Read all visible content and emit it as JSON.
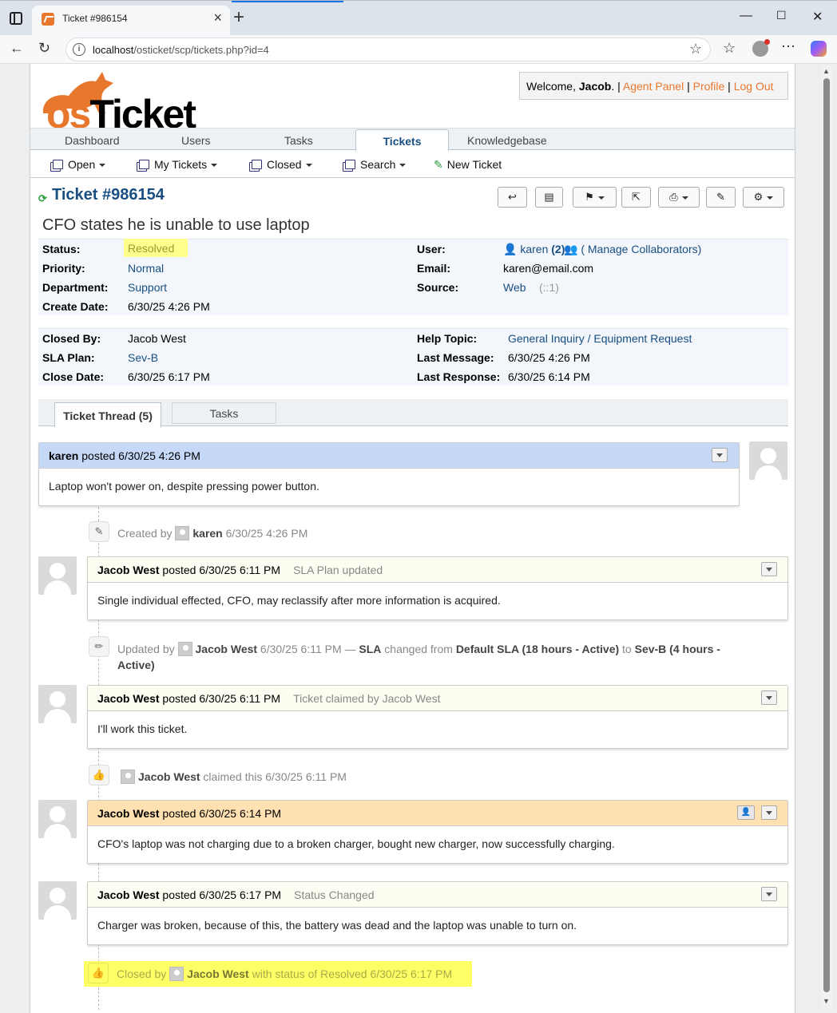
{
  "browser": {
    "tab_title": "Ticket #986154",
    "url_host": "localhost",
    "url_path": "/osticket/scp/tickets.php?id=4"
  },
  "header": {
    "logo_prefix": "os",
    "logo_suffix": "Ticket",
    "welcome_prefix": "Welcome, ",
    "user_name": "Jacob",
    "welcome_suffix": ". | ",
    "agent_panel": "Agent Panel",
    "sep1": " | ",
    "profile": "Profile",
    "sep2": " | ",
    "logout": "Log Out"
  },
  "nav": {
    "tabs": [
      "Dashboard",
      "Users",
      "Tasks",
      "Tickets",
      "Knowledgebase"
    ],
    "active": "Tickets"
  },
  "subnav": {
    "items": [
      "Open",
      "My Tickets",
      "Closed",
      "Search",
      "New Ticket"
    ]
  },
  "ticket": {
    "number": "Ticket #986154",
    "subject": "CFO states he is unable to use laptop",
    "info1": {
      "status_label": "Status:",
      "status": "Resolved",
      "priority_label": "Priority:",
      "priority": "Normal",
      "department_label": "Department:",
      "department": "Support",
      "create_date_label": "Create Date:",
      "create_date": "6/30/25 4:26 PM",
      "user_label": "User:",
      "user": "karen",
      "user_count": "(2)",
      "collaborators": "( Manage Collaborators)",
      "email_label": "Email:",
      "email": "karen@email.com",
      "source_label": "Source:",
      "source": "Web",
      "source_extra": "(::1)"
    },
    "info2": {
      "closed_by_label": "Closed By:",
      "closed_by": "Jacob West",
      "sla_label": "SLA Plan:",
      "sla": "Sev-B",
      "close_date_label": "Close Date:",
      "close_date": "6/30/25 6:17 PM",
      "help_topic_label": "Help Topic:",
      "help_topic": "General Inquiry / Equipment Request",
      "last_message_label": "Last Message:",
      "last_message": "6/30/25 4:26 PM",
      "last_response_label": "Last Response:",
      "last_response": "6/30/25 6:14 PM"
    }
  },
  "thread_tabs": {
    "active": "Ticket Thread (5)",
    "other": "Tasks"
  },
  "thread": {
    "e1": {
      "author": "karen",
      "posted": " posted 6/30/25 4:26 PM",
      "message": "Laptop won't power on, despite pressing power button."
    },
    "ev1": {
      "prefix": "Created by ",
      "who": "karen",
      "when": " 6/30/25 4:26 PM"
    },
    "e2": {
      "author": "Jacob West",
      "posted": " posted 6/30/25 6:11 PM",
      "extra": "SLA Plan updated",
      "message": "Single individual effected, CFO, may reclassify after more information is acquired."
    },
    "ev2": {
      "prefix": "Updated by ",
      "who": "Jacob West",
      "when": " 6/30/25 6:11 PM — ",
      "field": "SLA",
      "changed": " changed from ",
      "from": "Default SLA (18 hours - Active)",
      "to_word": " to ",
      "to": "Sev-B (4 hours -",
      "to_cont": "Active)"
    },
    "e3": {
      "author": "Jacob West",
      "posted": " posted 6/30/25 6:11 PM",
      "extra": "Ticket claimed by Jacob West",
      "message": "I'll work this ticket."
    },
    "ev3": {
      "who": "Jacob West",
      "rest": " claimed this 6/30/25 6:11 PM"
    },
    "e4": {
      "author": "Jacob West",
      "posted": " posted 6/30/25 6:14 PM",
      "message": "CFO's laptop was not charging due to a broken charger, bought new charger, now successfully charging."
    },
    "e5": {
      "author": "Jacob West",
      "posted": " posted 6/30/25 6:17 PM",
      "extra": "Status Changed",
      "message": "Charger was broken, because of this, the battery was dead and the laptop was unable to turn on."
    },
    "ev4": {
      "prefix": "Closed by ",
      "who": "Jacob West",
      "rest": " with status of Resolved 6/30/25 6:17 PM"
    }
  },
  "colors": {
    "brand": "#e8772e",
    "link": "#184e81",
    "customer_header": "#c5d8f7",
    "agent_header": "#fdfdf1",
    "internal_note_header": "#ffe0b0",
    "highlight": "#ffff66"
  }
}
